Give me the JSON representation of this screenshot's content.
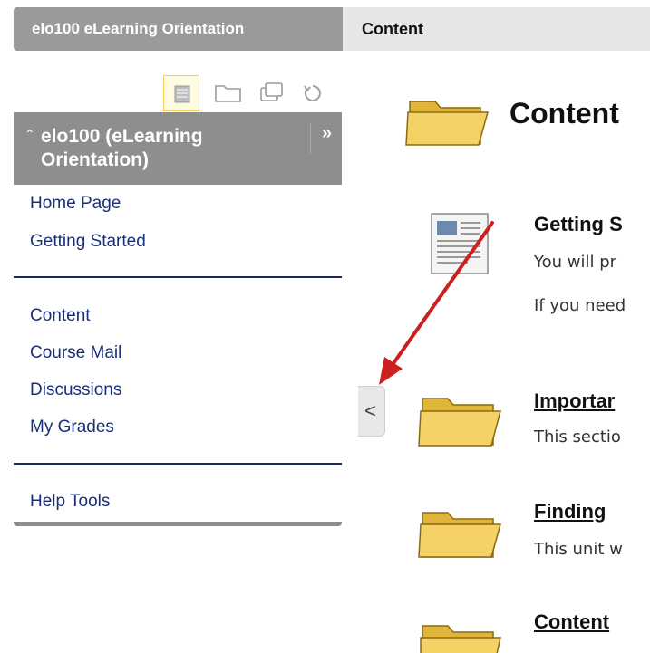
{
  "breadcrumb": {
    "course": "elo100 eLearning Orientation",
    "page": "Content"
  },
  "sidebar": {
    "tools": [
      {
        "icon": "list-view-icon",
        "active": true
      },
      {
        "icon": "folder-view-icon",
        "active": false
      },
      {
        "icon": "window-view-icon",
        "active": false
      },
      {
        "icon": "refresh-icon",
        "active": false
      }
    ],
    "course_title": "elo100 (eLearning Orientation)",
    "expand_label": "»",
    "collapse_label": "«",
    "items_group1": [
      "Home Page",
      "Getting Started"
    ],
    "items_group2": [
      "Content",
      "Course Mail",
      "Discussions",
      "My Grades"
    ],
    "items_group3": [
      "Help Tools"
    ]
  },
  "collapse_tab": {
    "label": "<"
  },
  "main": {
    "title": "Content",
    "items": [
      {
        "title": "Getting S",
        "desc": [
          "You will pr",
          "If you need"
        ],
        "icon": "document-icon"
      },
      {
        "title": "Importar",
        "desc": [
          "This sectio"
        ],
        "icon": "folder-icon"
      },
      {
        "title": "Finding",
        "desc": [
          "This unit w"
        ],
        "icon": "folder-icon"
      },
      {
        "title": "Content",
        "desc": [],
        "icon": "folder-icon"
      }
    ]
  },
  "colors": {
    "arrow": "#cc1f1f",
    "link": "#1a2f7a",
    "header_gray": "#8e8e8e",
    "folder_yellow": "#f2c94c"
  }
}
